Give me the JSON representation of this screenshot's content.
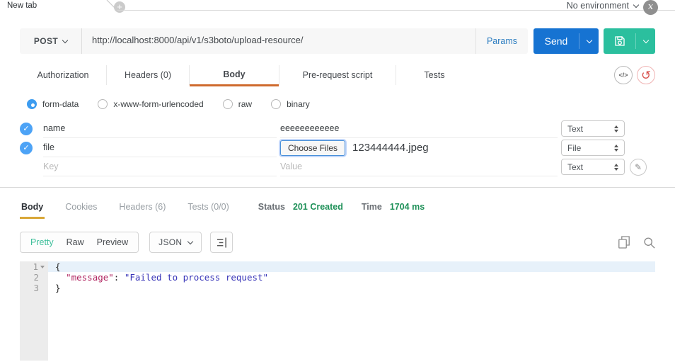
{
  "topbar": {
    "tab_title": "New tab",
    "environment_label": "No environment"
  },
  "request": {
    "method": "POST",
    "url": "http://localhost:8000/api/v1/s3boto/upload-resource/",
    "params_label": "Params",
    "send_label": "Send"
  },
  "request_tabs": {
    "active": "Body",
    "items": [
      {
        "label": "Authorization"
      },
      {
        "label": "Headers (0)"
      },
      {
        "label": "Body"
      },
      {
        "label": "Pre-request script"
      },
      {
        "label": "Tests"
      }
    ]
  },
  "body_modes": {
    "selected": "form-data",
    "items": [
      {
        "label": "form-data"
      },
      {
        "label": "x-www-form-urlencoded"
      },
      {
        "label": "raw"
      },
      {
        "label": "binary"
      }
    ]
  },
  "form_table": {
    "rows": [
      {
        "key": "name",
        "value": "eeeeeeeeeeee",
        "type": "Text",
        "checked": true
      },
      {
        "key": "file",
        "choose_button": "Choose Files",
        "filename": "123444444.jpeg",
        "type": "File",
        "checked": true
      },
      {
        "key_placeholder": "Key",
        "value_placeholder": "Value",
        "type": "Text",
        "checked": false
      }
    ]
  },
  "response": {
    "active_tab": "Body",
    "tabs": [
      {
        "label": "Body"
      },
      {
        "label": "Cookies"
      },
      {
        "label": "Headers (6)"
      },
      {
        "label": "Tests (0/0)"
      }
    ],
    "status_label": "Status",
    "status_value": "201 Created",
    "time_label": "Time",
    "time_value": "1704 ms",
    "view_modes": {
      "active": "Pretty",
      "items": [
        {
          "label": "Pretty"
        },
        {
          "label": "Raw"
        },
        {
          "label": "Preview"
        }
      ]
    },
    "format_selector": "JSON",
    "editor": {
      "line_numbers": [
        "1",
        "2",
        "3"
      ],
      "line1": "{",
      "line2": {
        "indent": "  ",
        "key": "\"message\"",
        "separator": ": ",
        "value": "\"Failed to process request\""
      },
      "line3": "}"
    }
  },
  "icons": {
    "new_tab": "plus-icon",
    "environment_quick_look": "x-eye-icon",
    "save": "floppy-disk-icon",
    "generate_code": "code-icon",
    "reset": "restore-icon",
    "edit": "pencil-icon",
    "wrap": "align-right-icon",
    "copy": "copy-icon",
    "search": "search-icon"
  },
  "colors": {
    "send_blue": "#1673d2",
    "save_teal": "#2bbf9e",
    "link_blue": "#2a7cc0",
    "check_blue": "#4da3f6",
    "radio_blue": "#3d9cf0",
    "status_green": "#1f9159",
    "request_tab_underline": "#cf6a2e",
    "response_tab_underline": "#d9a738",
    "pretty_teal": "#3ebf9b",
    "reset_red": "#d9534f",
    "editor_key": "#b0235f",
    "editor_value": "#3734b8",
    "editor_line_highlight": "#e7f1fa"
  }
}
